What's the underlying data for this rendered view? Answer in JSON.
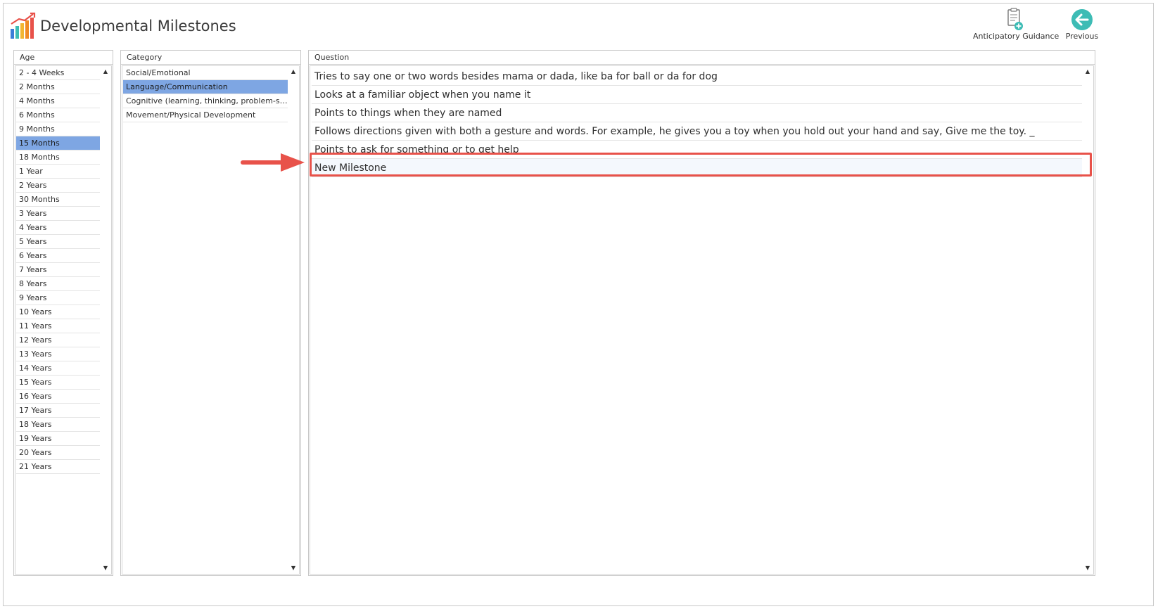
{
  "header": {
    "title": "Developmental Milestones",
    "toolbar": {
      "anticipatory_guidance_label": "Anticipatory Guidance",
      "previous_label": "Previous"
    }
  },
  "age_panel": {
    "header": "Age",
    "selected_index": 5,
    "items": [
      "2 - 4 Weeks",
      "2 Months",
      "4 Months",
      "6 Months",
      "9 Months",
      "15 Months",
      "18 Months",
      "1 Year",
      "2 Years",
      "30 Months",
      "3 Years",
      "4 Years",
      "5 Years",
      "6 Years",
      "7 Years",
      "8 Years",
      "9 Years",
      "10 Years",
      "11 Years",
      "12 Years",
      "13 Years",
      "14 Years",
      "15 Years",
      "16 Years",
      "17 Years",
      "18 Years",
      "19 Years",
      "20 Years",
      "21 Years"
    ]
  },
  "category_panel": {
    "header": "Category",
    "selected_index": 1,
    "items": [
      "Social/Emotional",
      "Language/Communication",
      "Cognitive (learning, thinking, problem-solvi...",
      "Movement/Physical Development"
    ]
  },
  "question_panel": {
    "header": "Question",
    "items": [
      "Tries to say one or two words besides mama or dada, like ba for ball or da for dog",
      "Looks at a familiar object when you name it",
      "Points to things when they are named",
      "Follows directions given with both a gesture and words. For example, he gives you a toy when you hold out your hand and say, Give me the toy. _",
      "Points to ask for something or to get help",
      "New Milestone"
    ]
  },
  "colors": {
    "selection": "#7ea6e3",
    "annotation": "#e8524a",
    "icon_teal": "#3dbcb5"
  },
  "icons": {
    "app_logo": "bar-chart-growth-icon",
    "anticipatory_guidance": "clipboard-add-icon",
    "previous": "arrow-left-circle-icon"
  }
}
